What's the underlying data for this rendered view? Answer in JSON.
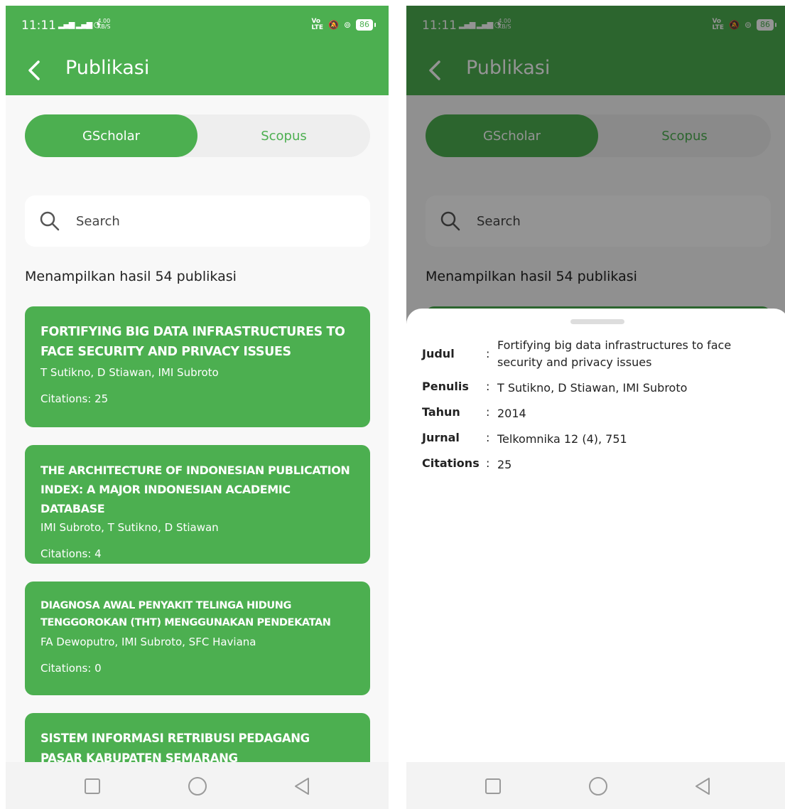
{
  "status_bar": {
    "time": "11:11",
    "net_speed_value": "4.00",
    "net_speed_unit": "KB/S",
    "volte_top": "Vo",
    "volte_bottom": "LTE",
    "battery": "86"
  },
  "app_bar": {
    "title": "Publikasi"
  },
  "tabs": [
    {
      "label": "GScholar",
      "selected": true
    },
    {
      "label": "Scopus",
      "selected": false
    }
  ],
  "search": {
    "placeholder": "Search",
    "value": ""
  },
  "results_summary": "Menampilkan hasil 54 publikasi",
  "publications": [
    {
      "title": "Fortifying big data infrastructures to face security and privacy issues",
      "authors": "T Sutikno, D Stiawan, IMI Subroto",
      "citations": "Citations: 25"
    },
    {
      "title": "The architecture of Indonesian publication index: A major Indonesian academic database",
      "authors": "IMI Subroto, T Sutikno, D Stiawan",
      "citations": "Citations: 4"
    },
    {
      "title": "Diagnosa Awal Penyakit Telinga Hidung Tenggorokan (THT) Menggunakan Pendekatan",
      "authors": "FA Dewoputro, IMI Subroto, SFC Haviana",
      "citations": "Citations: 0"
    },
    {
      "title": "Sistem Informasi Retribusi Pedagang Pasar Kabupaten Semarang",
      "authors": "",
      "citations": ""
    }
  ],
  "detail_sheet": {
    "separator": ":",
    "rows": [
      {
        "label": "Judul",
        "value": "Fortifying big data infrastructures to face security and privacy issues"
      },
      {
        "label": "Penulis",
        "value": "T Sutikno, D Stiawan, IMI Subroto"
      },
      {
        "label": "Tahun",
        "value": "2014"
      },
      {
        "label": "Jurnal",
        "value": "Telkomnika 12 (4), 751"
      },
      {
        "label": "Citations",
        "value": "25"
      }
    ]
  },
  "colors": {
    "primary": "#4caf50",
    "tab_track": "#eeeeee",
    "background": "#f8f8f8",
    "text": "#222222"
  }
}
